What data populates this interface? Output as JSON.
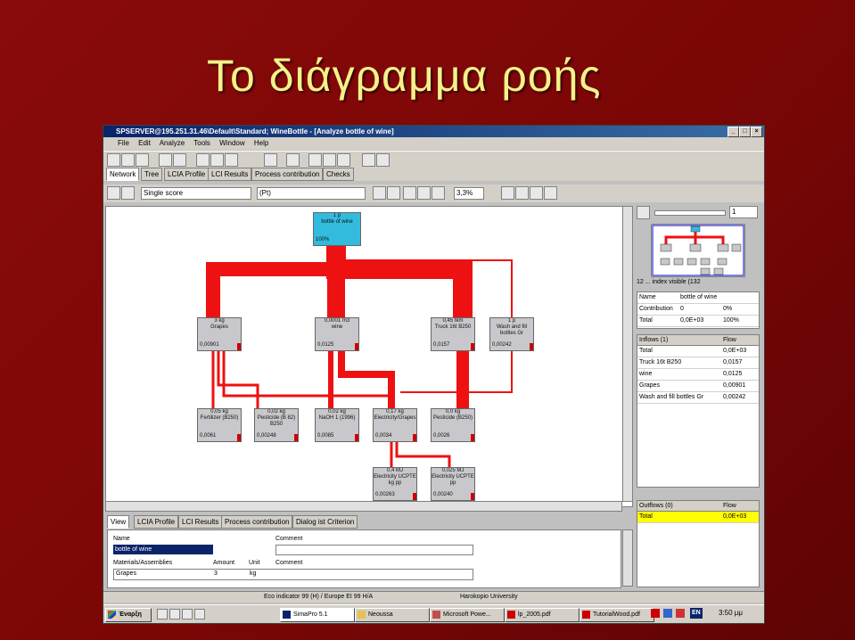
{
  "slide": {
    "title": "Το διάγραμμα ροής"
  },
  "app": {
    "title": "SPSERVER@195.251.31.46\\Default\\Standard; WineBottle - [Analyze bottle of wine]",
    "menu": [
      "File",
      "Edit",
      "Analyze",
      "Tools",
      "Window",
      "Help"
    ]
  },
  "tabs": [
    "Network",
    "Tree",
    "LCIA Profile",
    "LCI Results",
    "Process contribution",
    "Checks"
  ],
  "controls": {
    "method": "Single score",
    "unit": "(Pt)",
    "cutoff": "3,3%",
    "zoom_value": "1"
  },
  "network": {
    "root": {
      "name": "1 p",
      "sub": "bottle of wine",
      "val": "100%"
    },
    "nodes": [
      {
        "name": "3 kg",
        "sub": "Grapes",
        "val": "0,00901"
      },
      {
        "name": "0,0001 m3",
        "sub": "wine",
        "val": "0,0125"
      },
      {
        "name": "0,45 tkm",
        "sub": "Truck 16t B250",
        "val": "0,0157"
      },
      {
        "name": "1 p",
        "sub": "Wash and fill bottles Gr",
        "val": "0,00242"
      },
      {
        "name": "0,05 kg",
        "sub": "Fertilizer (B250)",
        "val": "0,0061"
      },
      {
        "name": "0,02 kg",
        "sub": "Pesticide (B 82) B250",
        "val": "0,00248"
      },
      {
        "name": "0,02 kg",
        "sub": "NaOH 1 (1996)",
        "val": "0,0085"
      },
      {
        "name": "0,17 kg",
        "sub": "Electricity/Grapes",
        "val": "0,0034"
      },
      {
        "name": "0,0 kg",
        "sub": "Pesticide (B250)",
        "val": "0,0026"
      },
      {
        "name": "0,4 MJ",
        "sub": "Electricity UCPTE kg pp",
        "val": "0,00263"
      },
      {
        "name": "0,025 MJ",
        "sub": "Electricity UCPTE pp",
        "val": "0,00240"
      }
    ]
  },
  "right": {
    "process_count": "12 ... index visible (132",
    "info": [
      {
        "label": "Name",
        "value": "bottle of wine"
      },
      {
        "label": "Contribution",
        "value": "0",
        "extra": "0%"
      },
      {
        "label": "Total",
        "value": "0,0E+03",
        "extra": "100%"
      }
    ],
    "inflows_header": {
      "name": "Inflows (1)",
      "flow": "Flow"
    },
    "inflows": [
      {
        "name": "Total",
        "flow": "0,0E+03"
      },
      {
        "name": "Truck 16t B250",
        "flow": "0,0157"
      },
      {
        "name": "wine",
        "flow": "0,0125"
      },
      {
        "name": "Grapes",
        "flow": "0,00901"
      },
      {
        "name": "Wash and fill bottles Gr",
        "flow": "0,00242"
      }
    ],
    "outflows_header": {
      "name": "Outflows (0)",
      "flow": "Flow"
    },
    "outflows": [
      {
        "name": "Total",
        "flow": "0,0E+03"
      }
    ]
  },
  "bottom": {
    "tabs": [
      "View",
      "LCIA Profile",
      "LCI Results",
      "Process contribution",
      "Dialog ist Criterion"
    ],
    "name_label": "Name",
    "name_value": "bottle of wine",
    "comment_label": "Comment",
    "materials_label": "Materials/Assemblies",
    "amount_label": "Amount",
    "unit_label": "Unit",
    "row": {
      "material": "Grapes",
      "amount": "3",
      "unit": "kg"
    }
  },
  "status": {
    "method": "Eco indicator 99 (H) / Europe EI 99 H/A",
    "org": "Harokopio University"
  },
  "taskbar": {
    "start": "Έναρξη",
    "items": [
      "SimaPro 5.1",
      "Neoussa",
      "Microsoft Powe...",
      "lp_2005.pdf",
      "TutorialWood.pdf"
    ],
    "lang": "EN",
    "clock": "3:50 μμ"
  },
  "colors": {
    "flow": "#ee1111",
    "root_node": "#33bbdd",
    "title_text": "#f2f28a"
  }
}
